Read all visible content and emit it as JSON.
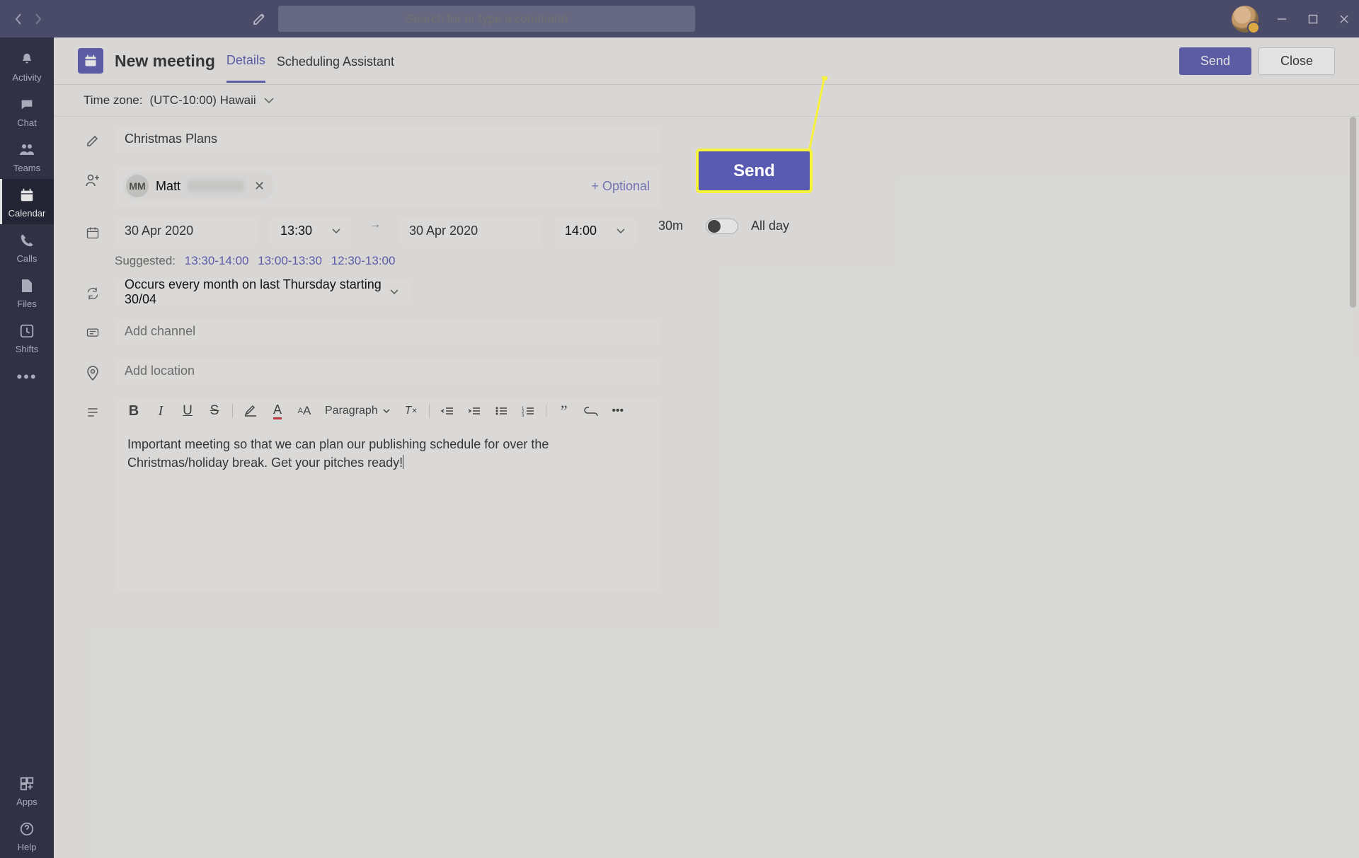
{
  "search": {
    "placeholder": "Search for or type a command"
  },
  "rail": {
    "activity": "Activity",
    "chat": "Chat",
    "teams": "Teams",
    "calendar": "Calendar",
    "calls": "Calls",
    "files": "Files",
    "shifts": "Shifts",
    "apps": "Apps",
    "help": "Help"
  },
  "header": {
    "title": "New meeting",
    "tab_details": "Details",
    "tab_sched": "Scheduling Assistant",
    "send": "Send",
    "close": "Close"
  },
  "timezone": {
    "label": "Time zone:",
    "value": "(UTC-10:00) Hawaii"
  },
  "form": {
    "title": "Christmas Plans",
    "attendee": {
      "initials": "MM",
      "name": "Matt"
    },
    "optional": "+ Optional",
    "start_date": "30 Apr 2020",
    "start_time": "13:30",
    "end_date": "30 Apr 2020",
    "end_time": "14:00",
    "duration": "30m",
    "all_day": "All day",
    "suggested_label": "Suggested:",
    "suggested": [
      "13:30-14:00",
      "13:00-13:30",
      "12:30-13:00"
    ],
    "recurrence": "Occurs every month on last Thursday starting 30/04",
    "channel_ph": "Add channel",
    "location_ph": "Add location",
    "paragraph_label": "Paragraph",
    "body": "Important meeting so that we can plan our publishing schedule for over the Christmas/holiday break. Get your pitches ready!"
  },
  "callout": {
    "send": "Send"
  }
}
